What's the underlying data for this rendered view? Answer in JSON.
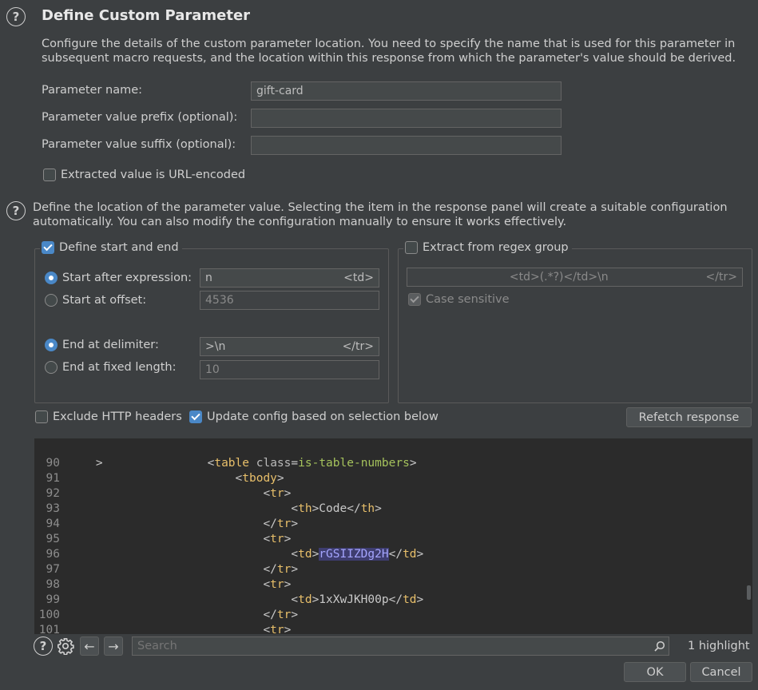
{
  "dialog": {
    "title": "Define Custom Parameter",
    "description": "Configure the details of the custom parameter location. You need to specify the name that is used for this parameter in subsequent macro requests, and the location within this response from which the parameter's value should be derived."
  },
  "form": {
    "name_label": "Parameter name:",
    "name_value": "gift-card",
    "prefix_label": "Parameter value prefix (optional):",
    "prefix_value": "",
    "suffix_label": "Parameter value suffix (optional):",
    "suffix_value": "",
    "url_encoded_label": "Extracted value is URL-encoded"
  },
  "location": {
    "description": "Define the location of the parameter value. Selecting the item in the response panel will create a suitable configuration automatically. You can also modify the configuration manually to ensure it works effectively."
  },
  "start_end": {
    "group_label": "Define start and end",
    "start_after_label": "Start after expression:",
    "start_after_value": "n",
    "start_after_hint": "<td>",
    "start_offset_label": "Start at offset:",
    "start_offset_value": "4536",
    "end_delim_label": "End at delimiter:",
    "end_delim_value": ">\\n",
    "end_delim_hint": "</tr>",
    "end_fixed_label": "End at fixed length:",
    "end_fixed_value": "10"
  },
  "regex": {
    "group_label": "Extract from regex group",
    "value": "<td>(.*?)</td>\\n",
    "hint": "</tr>",
    "case_label": "Case sensitive"
  },
  "options": {
    "exclude_headers_label": "Exclude HTTP headers",
    "update_config_label": "Update config based on selection below",
    "refetch_label": "Refetch response"
  },
  "editor": {
    "top_partial": ">",
    "lines": [
      {
        "n": "90",
        "indent": 5,
        "tag": "table",
        "close": false,
        "attr": "class",
        "val": "is-table-numbers"
      },
      {
        "n": "91",
        "indent": 6,
        "tag": "tbody",
        "close": false
      },
      {
        "n": "92",
        "indent": 7,
        "tag": "tr",
        "close": false
      },
      {
        "n": "93",
        "indent": 8,
        "tag": "th",
        "text": "Code",
        "endtag": "th"
      },
      {
        "n": "94",
        "indent": 7,
        "tag": "tr",
        "close": true
      },
      {
        "n": "95",
        "indent": 7,
        "tag": "tr",
        "close": false
      },
      {
        "n": "96",
        "indent": 8,
        "tag": "td",
        "selected": "rGSIIZDg2H",
        "endtag": "td"
      },
      {
        "n": "97",
        "indent": 7,
        "tag": "tr",
        "close": true
      },
      {
        "n": "98",
        "indent": 7,
        "tag": "tr",
        "close": false
      },
      {
        "n": "99",
        "indent": 8,
        "tag": "td",
        "text": "1xXwJKH00p",
        "endtag": "td"
      },
      {
        "n": "100",
        "indent": 7,
        "tag": "tr",
        "close": true
      },
      {
        "n": "101",
        "indent": 7,
        "tag": "tr",
        "close": false
      }
    ]
  },
  "search": {
    "placeholder": "Search",
    "highlight_count": "1 highlight"
  },
  "footer": {
    "ok_label": "OK",
    "cancel_label": "Cancel"
  }
}
